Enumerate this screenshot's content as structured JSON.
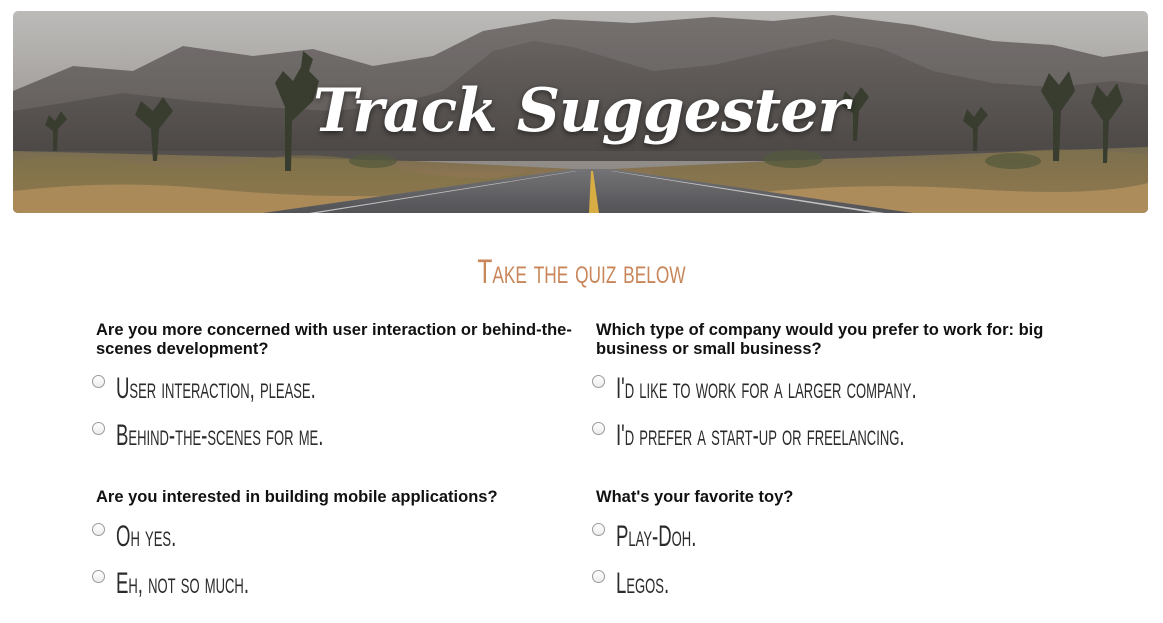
{
  "header": {
    "title": "Track Suggester"
  },
  "subtitle": "Take the quiz below",
  "questions": [
    {
      "text": "Are you more concerned with user interaction or behind-the-scenes development?",
      "options": [
        "User interaction, please.",
        "Behind-the-scenes for me."
      ]
    },
    {
      "text": "Which type of company would you prefer to work for: big business or small business?",
      "options": [
        "I'd like to work for a larger company.",
        "I'd prefer a start-up or freelancing."
      ]
    },
    {
      "text": "Are you interested in building mobile applications?",
      "options": [
        "Oh yes.",
        "Eh, not so much."
      ]
    },
    {
      "text": "What's your favorite toy?",
      "options": [
        "Play-Doh.",
        "Legos."
      ]
    }
  ],
  "colors": {
    "subtitle": "#c8865a",
    "question_text": "#111111",
    "option_text": "#2b2b2b",
    "banner_title": "#ffffff"
  },
  "icons": {
    "radio": "radio-unchecked-icon"
  }
}
